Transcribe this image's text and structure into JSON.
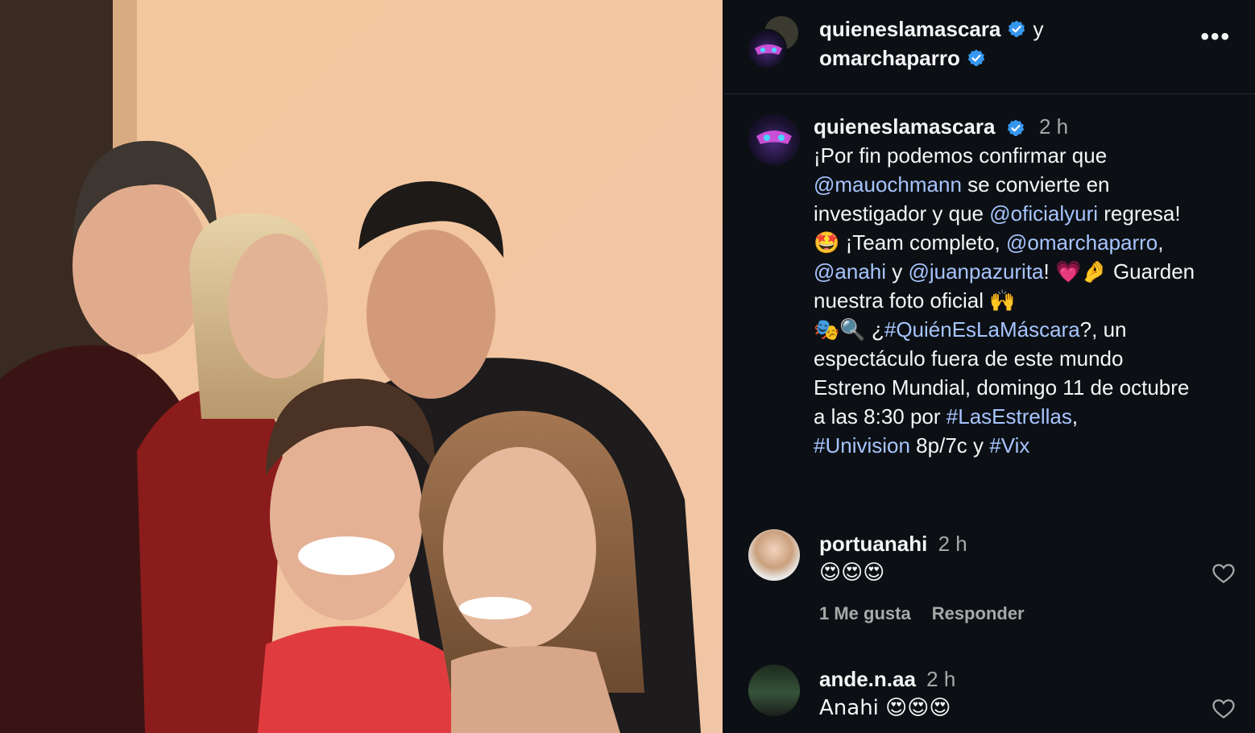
{
  "header": {
    "user1": "quieneslamascara",
    "separator": "y",
    "user2": "omarchaparro",
    "more_icon": "•••"
  },
  "caption": {
    "username": "quieneslamascara",
    "time": "2 h",
    "lines": [
      [
        {
          "t": "¡Por fin podemos confirmar que"
        }
      ],
      [
        {
          "t": "@mauochmann",
          "m": true
        },
        {
          "t": " se convierte en"
        }
      ],
      [
        {
          "t": "investigador y que "
        },
        {
          "t": "@oficialyuri",
          "m": true
        },
        {
          "t": " regresa!"
        }
      ],
      [
        {
          "t": "🤩 ¡Team completo, "
        },
        {
          "t": "@omarchaparro",
          "m": true
        },
        {
          "t": ","
        }
      ],
      [
        {
          "t": "@anahi",
          "m": true
        },
        {
          "t": " y "
        },
        {
          "t": "@juanpazurita",
          "m": true
        },
        {
          "t": "! 💗🤌 Guarden"
        }
      ],
      [
        {
          "t": "nuestra foto oficial 🙌"
        }
      ],
      [
        {
          "t": " "
        }
      ],
      [
        {
          "t": "🎭🔍 ¿"
        },
        {
          "t": "#QuiénEsLaMáscara",
          "m": true
        },
        {
          "t": "?, un"
        }
      ],
      [
        {
          "t": "espectáculo fuera de este mundo"
        }
      ],
      [
        {
          "t": "Estreno Mundial, domingo 11 de octubre"
        }
      ],
      [
        {
          "t": "a las 8:30 por "
        },
        {
          "t": "#LasEstrellas",
          "m": true
        },
        {
          "t": ","
        }
      ],
      [
        {
          "t": "#Univision",
          "m": true
        },
        {
          "t": " 8p/7c y "
        },
        {
          "t": "#Vix",
          "m": true
        }
      ]
    ]
  },
  "comments": [
    {
      "username": "portuanahi",
      "time": "2 h",
      "text": "😍😍😍",
      "likes": "1 Me gusta",
      "reply": "Responder"
    },
    {
      "username": "ande.n.aa",
      "time": "2 h",
      "text": "Anahi 😍😍😍"
    }
  ],
  "colors": {
    "panel_bg": "#0c1014",
    "link": "#a7c4ff",
    "verified": "#3797f0",
    "muted": "#a8a8a8"
  }
}
